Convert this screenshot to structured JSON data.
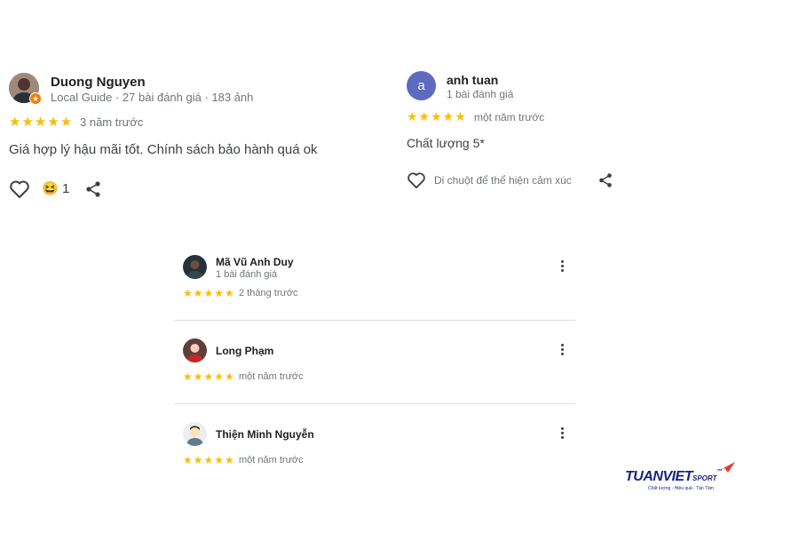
{
  "reviews_top": [
    {
      "name": "Duong Nguyen",
      "meta": "Local Guide · 27 bài đánh giá · 183 ảnh",
      "stars": "★★★★★",
      "time": "3 năm trước",
      "text": "Giá hợp lý hậu mãi tốt. Chính sách bảo hành quá ok",
      "reaction_count": "1",
      "reaction_emoji": "😆"
    },
    {
      "name": "anh tuan",
      "avatar_letter": "a",
      "meta": "1 bài đánh giá",
      "stars": "★★★★★",
      "time": "một năm trước",
      "text": "Chất lượng 5*",
      "reaction_hint": "Di chuột để thể hiện cảm xúc"
    }
  ],
  "reviews_list": [
    {
      "name": "Mã Vũ Anh Duy",
      "meta": "1 bài đánh giá",
      "stars": "★★★★★",
      "time": "2 tháng trước"
    },
    {
      "name": "Long Phạm",
      "stars": "★★★★★",
      "time": "một năm trước"
    },
    {
      "name": "Thiện Minh Nguyễn",
      "stars": "★★★★★",
      "time": "một năm trước"
    }
  ],
  "brand": {
    "name": "TUANVIET",
    "sub": "SPORT",
    "tm": "™",
    "tagline": "Chất lượng - Hiệu quả - Tận Tâm"
  },
  "colors": {
    "star": "#fbbc04",
    "avatar_letter_bg": "#5c6bc0",
    "brand_dark": "#1a237e",
    "brand_red": "#e53935"
  }
}
